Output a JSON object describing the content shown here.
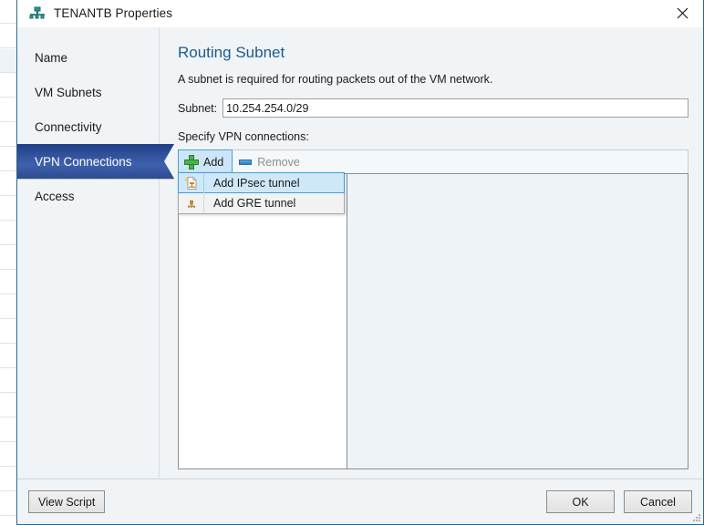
{
  "window": {
    "title": "TENANTB Properties",
    "icon": "network-subnet-icon",
    "close_label": "close-icon"
  },
  "sidebar": {
    "items": [
      {
        "label": "Name",
        "selected": false
      },
      {
        "label": "VM Subnets",
        "selected": false
      },
      {
        "label": "Connectivity",
        "selected": false
      },
      {
        "label": "VPN Connections",
        "selected": true
      },
      {
        "label": "Access",
        "selected": false
      }
    ]
  },
  "main": {
    "title": "Routing Subnet",
    "description": "A subnet is required for routing packets out of the VM network.",
    "subnet_field": {
      "label": "Subnet:",
      "value": "10.254.254.0/29",
      "placeholder": ""
    },
    "vpn_section_label": "Specify VPN connections:",
    "toolbar": {
      "add_label": "Add",
      "add_icon": "plus-icon",
      "remove_label": "Remove",
      "remove_icon": "minus-icon",
      "add_active": true,
      "remove_disabled": true
    },
    "add_menu": {
      "items": [
        {
          "label": "Add IPsec tunnel",
          "icon": "ipsec-tunnel-icon",
          "highlighted": true
        },
        {
          "label": "Add GRE tunnel",
          "icon": "gre-tunnel-icon",
          "highlighted": false
        }
      ]
    },
    "connection_list": {
      "items": []
    }
  },
  "footer": {
    "view_script_label": "View Script",
    "ok_label": "OK",
    "cancel_label": "Cancel"
  },
  "colors": {
    "accent_blue": "#1f5a8f",
    "selection_blue": "#33539e",
    "dialog_bg": "#f0f4f7",
    "border": "#2a6c8f",
    "add_icon_green": "#4bb14b",
    "remove_icon_blue": "#2f7fc0",
    "highlight_bg": "#cfe8f8"
  }
}
